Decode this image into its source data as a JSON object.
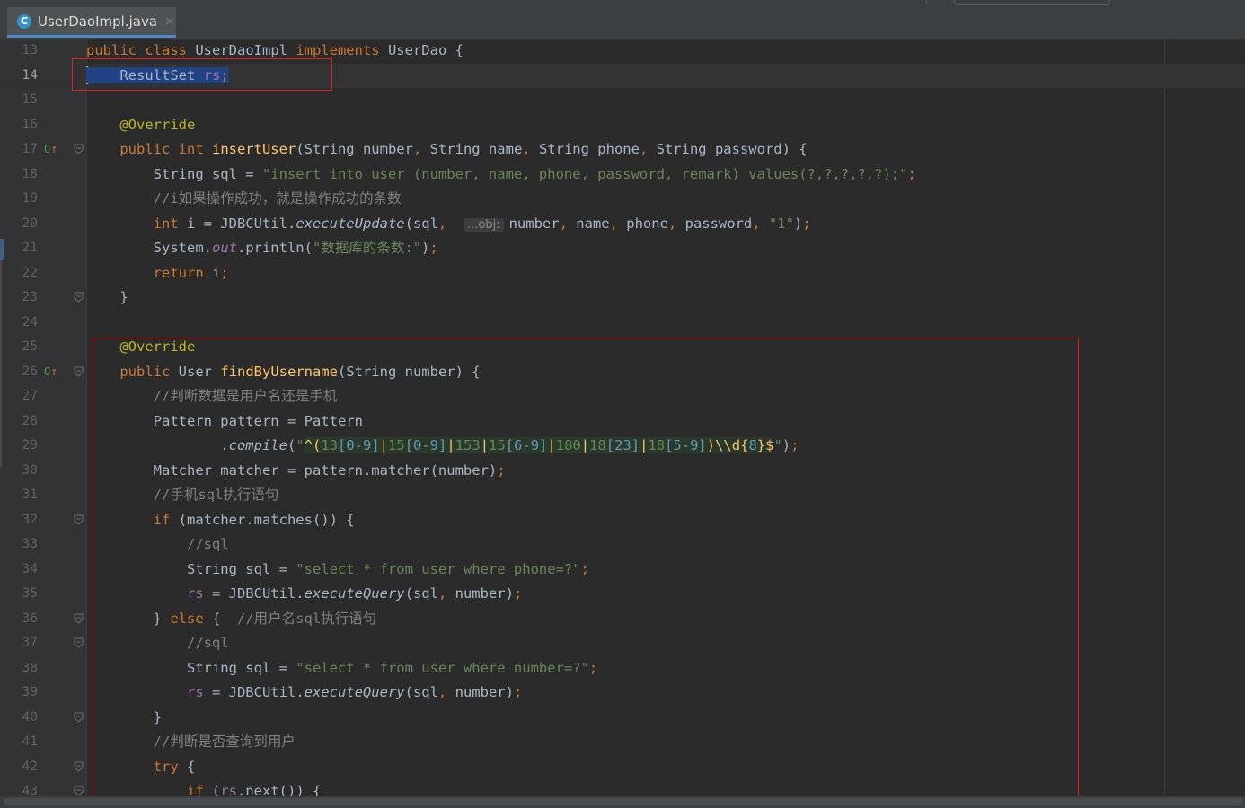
{
  "tab": {
    "icon_letter": "C",
    "filename": "UserDaoImpl.java",
    "close": "×"
  },
  "lines": [
    {
      "n": "13",
      "html": "<span class=\"kw\">public class </span>UserDaoImpl <span class=\"kw\">implements </span>UserDao {"
    },
    {
      "n": "14",
      "html": "<span class=\"caret\"></span><span class=\"sel\">    ResultSet <span class=\"fd\">rs</span><span class=\"kw\">;</span></span>"
    },
    {
      "n": "15",
      "html": ""
    },
    {
      "n": "16",
      "html": "    <span class=\"an\">@Override</span>"
    },
    {
      "n": "17",
      "html": "    <span class=\"kw\">public int </span><span class=\"fn\">insertUser</span>(String number<span class=\"kw\">, </span>String name<span class=\"kw\">, </span>String phone<span class=\"kw\">, </span>String password) {"
    },
    {
      "n": "18",
      "html": "        String sql = <span class=\"st\">\"insert into user (number, name, phone, password, remark) values(?,?,?,?,?);\"</span><span class=\"kw\">;</span>"
    },
    {
      "n": "19",
      "html": "        <span class=\"cm\">//i如果操作成功，就是操作成功的条数</span>"
    },
    {
      "n": "20",
      "html": "        <span class=\"kw\">int </span>i = JDBCUtil.<span class=\"it\">executeUpdate</span>(sql<span class=\"kw\">, </span> <span class=\"hint\">...obj:</span>number<span class=\"kw\">, </span>name<span class=\"kw\">, </span>phone<span class=\"kw\">, </span>password<span class=\"kw\">, </span><span class=\"st\">\"1\"</span>)<span class=\"kw\">;</span>"
    },
    {
      "n": "21",
      "html": "        System.<span class=\"fd it\">out</span>.println(<span class=\"st\">\"数据库的条数:\"</span>)<span class=\"kw\">;</span>"
    },
    {
      "n": "22",
      "html": "        <span class=\"kw\">return </span>i<span class=\"kw\">;</span>"
    },
    {
      "n": "23",
      "html": "    }"
    },
    {
      "n": "24",
      "html": ""
    },
    {
      "n": "25",
      "html": "    <span class=\"an\">@Override</span>"
    },
    {
      "n": "26",
      "html": "    <span class=\"kw\">public </span>User <span class=\"fn\">findByUsername</span>(String number) {"
    },
    {
      "n": "27",
      "html": "        <span class=\"cm\">//判断数据是用户名还是手机</span>"
    },
    {
      "n": "28",
      "html": "        Pattern pattern = Pattern"
    },
    {
      "n": "29",
      "html": "                .<span class=\"it\">compile</span>(<span class=\"st\">\"</span><span class=\"rx\"><span class=\"rxg\">^(</span><span class=\"st\">13</span><span class=\"rxb\">[0-9]</span><span class=\"rxg\">|</span><span class=\"st\">15</span><span class=\"rxb\">[0-9]</span><span class=\"rxg\">|</span><span class=\"st\">153</span><span class=\"rxg\">|</span><span class=\"st\">15</span><span class=\"rxb\">[6-9]</span><span class=\"rxg\">|</span><span class=\"st\">180</span><span class=\"rxg\">|</span><span class=\"st\">18</span><span class=\"rxb\">[23]</span><span class=\"rxg\">|</span><span class=\"st\">18</span><span class=\"rxb\">[5-9]</span><span class=\"rxg\">)\\\\d{</span><span class=\"rxb\">8</span><span class=\"rxg\">}$</span></span><span class=\"st\">\"</span>)<span class=\"kw\">;</span>"
    },
    {
      "n": "30",
      "html": "        Matcher matcher = pattern.matcher(number)<span class=\"kw\">;</span>"
    },
    {
      "n": "31",
      "html": "        <span class=\"cm\">//手机sql执行语句</span>"
    },
    {
      "n": "32",
      "html": "        <span class=\"kw\">if </span>(matcher.matches()) {"
    },
    {
      "n": "33",
      "html": "            <span class=\"cm\">//sql</span>"
    },
    {
      "n": "34",
      "html": "            String sql = <span class=\"st\">\"select * from user where phone=?\"</span><span class=\"kw\">;</span>"
    },
    {
      "n": "35",
      "html": "            <span class=\"fd\">rs </span>= JDBCUtil.<span class=\"it\">executeQuery</span>(sql<span class=\"kw\">, </span>number)<span class=\"kw\">;</span>"
    },
    {
      "n": "36",
      "html": "        } <span class=\"kw\">else </span>{  <span class=\"cm\">//用户名sql执行语句</span>"
    },
    {
      "n": "37",
      "html": "            <span class=\"cm\">//sql</span>"
    },
    {
      "n": "38",
      "html": "            String sql = <span class=\"st\">\"select * from user where number=?\"</span><span class=\"kw\">;</span>"
    },
    {
      "n": "39",
      "html": "            <span class=\"fd\">rs </span>= JDBCUtil.<span class=\"it\">executeQuery</span>(sql<span class=\"kw\">, </span>number)<span class=\"kw\">;</span>"
    },
    {
      "n": "40",
      "html": "        }"
    },
    {
      "n": "41",
      "html": "        <span class=\"cm\">//判断是否查询到用户</span>"
    },
    {
      "n": "42",
      "html": "        <span class=\"kw\">try </span>{"
    },
    {
      "n": "43",
      "html": "            <span class=\"kw\">if </span>(<span class=\"fd\">rs</span>.next()) {"
    }
  ],
  "current_line": "14",
  "override_markers": [
    "17",
    "26"
  ],
  "fold_markers": [
    "17",
    "23",
    "26",
    "32",
    "36",
    "37",
    "40",
    "42",
    "43"
  ],
  "colors": {
    "background": "#2b2b2b",
    "gutter": "#313335",
    "keyword": "#cc7832",
    "string": "#6a8759",
    "annotation": "#bbb529",
    "method": "#ffc66d",
    "field": "#9876aa",
    "comment": "#808080",
    "highlight_box": "#e02020"
  }
}
